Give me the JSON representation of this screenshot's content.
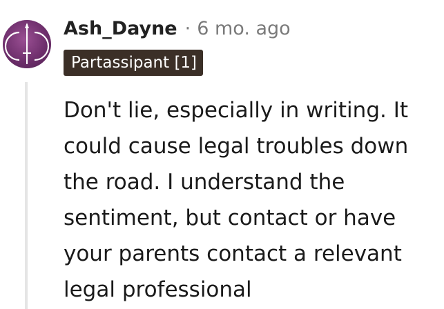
{
  "comment": {
    "author": "Ash_Dayne",
    "separator": "·",
    "timestamp": "6 mo. ago",
    "flair": "Partassipant [1]",
    "flair_color": "#3b2f27",
    "avatar_icon": "sword-crescent-avatar",
    "avatar_color": "#7a3a76",
    "body": "Don't lie, especially in writing. It could cause legal troubles down the road. I understand the sentiment, but contact or have your parents contact a relevant legal professional"
  }
}
